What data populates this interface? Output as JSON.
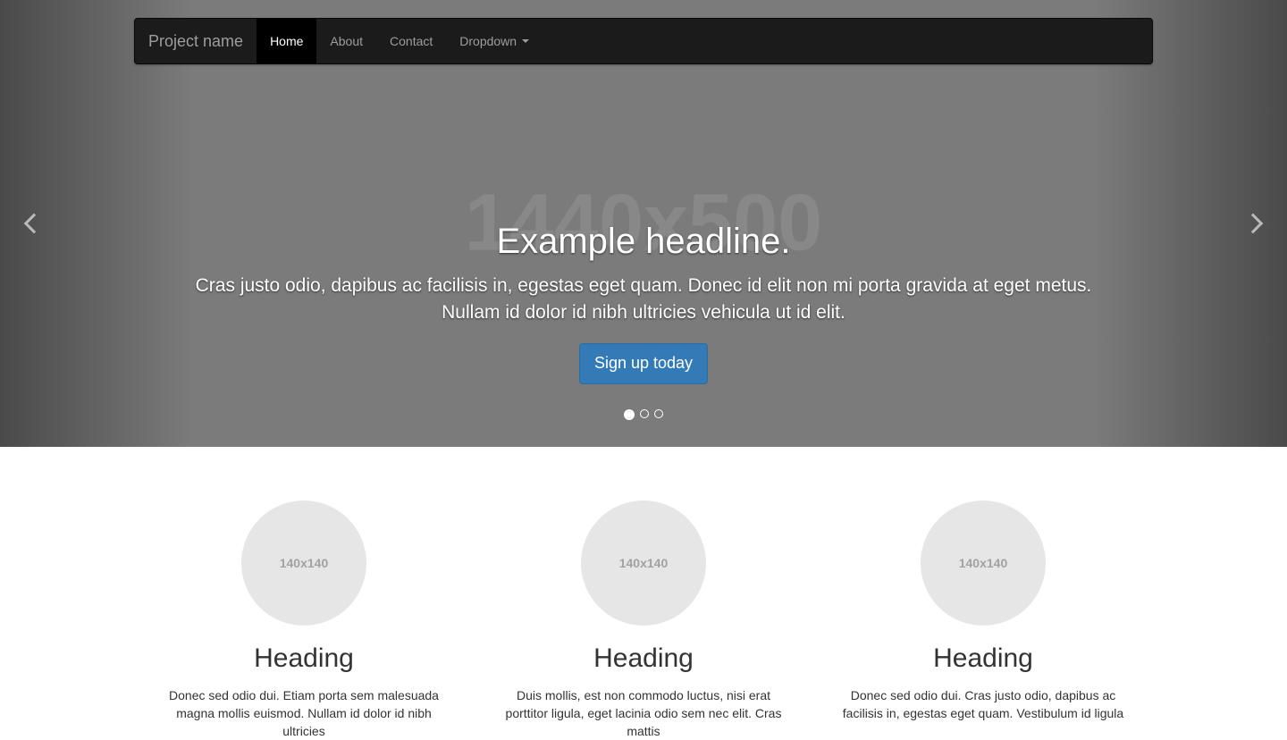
{
  "navbar": {
    "brand": "Project name",
    "items": [
      {
        "label": "Home",
        "active": true
      },
      {
        "label": "About",
        "active": false
      },
      {
        "label": "Contact",
        "active": false
      },
      {
        "label": "Dropdown",
        "active": false,
        "dropdown": true
      }
    ]
  },
  "carousel": {
    "placeholder": "1440x500",
    "headline": "Example headline.",
    "lead": "Cras justo odio, dapibus ac facilisis in, egestas eget quam. Donec id elit non mi porta gravida at eget metus. Nullam id dolor id nibh ultricies vehicula ut id elit.",
    "cta": "Sign up today",
    "slide_count": 3,
    "active_slide": 0
  },
  "features": [
    {
      "img_placeholder": "140x140",
      "heading": "Heading",
      "text": "Donec sed odio dui. Etiam porta sem malesuada magna mollis euismod. Nullam id dolor id nibh ultricies"
    },
    {
      "img_placeholder": "140x140",
      "heading": "Heading",
      "text": "Duis mollis, est non commodo luctus, nisi erat porttitor ligula, eget lacinia odio sem nec elit. Cras mattis"
    },
    {
      "img_placeholder": "140x140",
      "heading": "Heading",
      "text": "Donec sed odio dui. Cras justo odio, dapibus ac facilisis in, egestas eget quam. Vestibulum id ligula"
    }
  ]
}
